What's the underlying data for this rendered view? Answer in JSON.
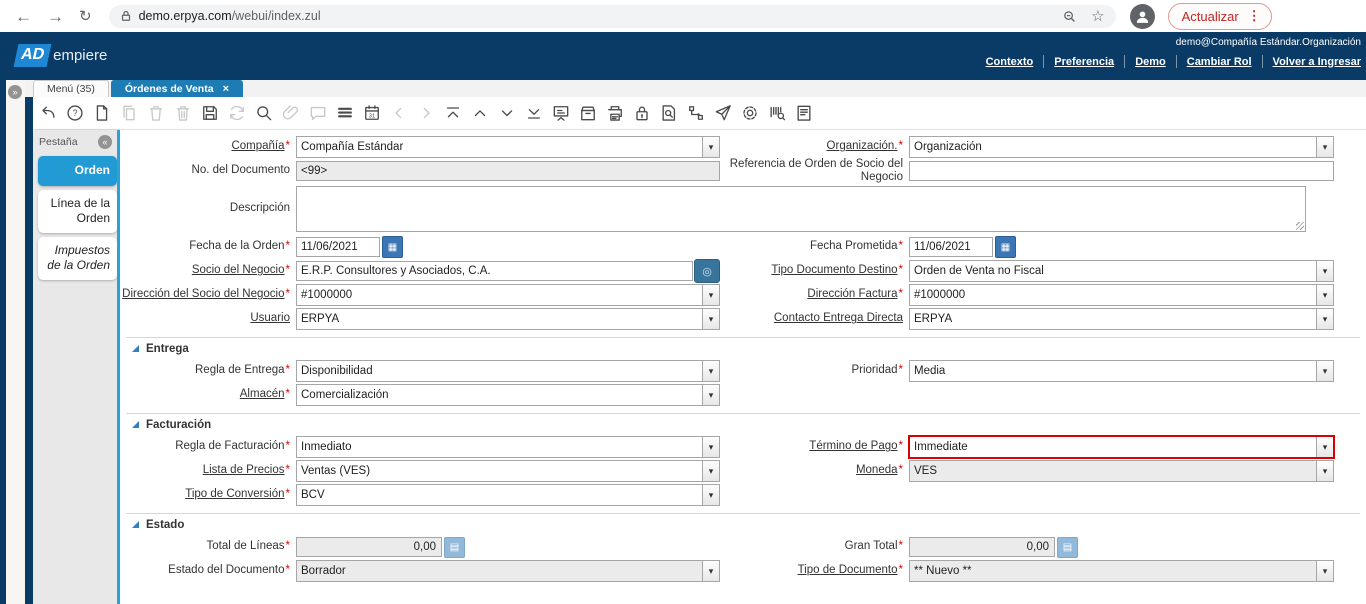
{
  "browser": {
    "url": {
      "domain": "demo.erpya.com",
      "path": "/webui/index.zul"
    },
    "refresh_button_label": "Actualizar"
  },
  "header": {
    "logo": {
      "ad": "AD",
      "rest": "empiere"
    },
    "session": "demo@Compañía Estándar.Organización",
    "links": [
      "Contexto",
      "Preferencia",
      "Demo",
      "Cambiar Rol",
      "Volver a Ingresar"
    ]
  },
  "tabbar": {
    "expand_button": "»",
    "tabs": [
      {
        "label": "Menú (35)",
        "active": false,
        "closable": false
      },
      {
        "label": "Órdenes de Venta",
        "active": true,
        "closable": true
      }
    ]
  },
  "toolbar": {
    "icons": [
      {
        "name": "undo",
        "enabled": true
      },
      {
        "name": "help",
        "enabled": true
      },
      {
        "name": "new-record",
        "enabled": true
      },
      {
        "name": "copy-record",
        "enabled": false
      },
      {
        "name": "delete-record",
        "enabled": false
      },
      {
        "name": "delete-selection",
        "enabled": false
      },
      {
        "name": "save",
        "enabled": true
      },
      {
        "name": "refresh",
        "enabled": false
      },
      {
        "name": "find",
        "enabled": true
      },
      {
        "name": "attachment",
        "enabled": false
      },
      {
        "name": "chat",
        "enabled": false
      },
      {
        "name": "grid-toggle",
        "enabled": true
      },
      {
        "name": "calendar",
        "enabled": true
      },
      {
        "name": "nav-left",
        "enabled": false
      },
      {
        "name": "nav-right",
        "enabled": false
      },
      {
        "name": "first-record",
        "enabled": true
      },
      {
        "name": "previous-record",
        "enabled": true
      },
      {
        "name": "next-record",
        "enabled": true
      },
      {
        "name": "last-record",
        "enabled": true
      },
      {
        "name": "report",
        "enabled": true
      },
      {
        "name": "archive",
        "enabled": true
      },
      {
        "name": "print",
        "enabled": true
      },
      {
        "name": "lock-private",
        "enabled": true
      },
      {
        "name": "record-info",
        "enabled": true
      },
      {
        "name": "workflow",
        "enabled": true
      },
      {
        "name": "request",
        "enabled": true
      },
      {
        "name": "preferences",
        "enabled": true
      },
      {
        "name": "product-info",
        "enabled": true
      },
      {
        "name": "report-view",
        "enabled": true
      }
    ]
  },
  "sidebar": {
    "title": "Pestaña",
    "collapse_button": "«",
    "tabs": [
      {
        "label": "Orden",
        "active": true,
        "italic": false
      },
      {
        "label": "Línea de la Orden",
        "active": false,
        "italic": false
      },
      {
        "label": "Impuestos de la Orden",
        "active": false,
        "italic": true
      }
    ]
  },
  "form": {
    "required_marker": "*",
    "sections": [
      {
        "title": "",
        "rows": [
          {
            "left": {
              "id": "compania",
              "label": "Compañía",
              "required": true,
              "underlined": true,
              "type": "combo",
              "value": "Compañía Estándar"
            },
            "right": {
              "id": "organizacion",
              "label": "Organización.",
              "required": true,
              "underlined": true,
              "type": "combo",
              "value": "Organización"
            }
          },
          {
            "left": {
              "id": "no-documento",
              "label": "No. del Documento",
              "required": false,
              "underlined": false,
              "type": "text-readonly",
              "value": "<99>"
            },
            "right": {
              "id": "referencia-orden-socio",
              "label": "Referencia de Orden de Socio del Negocio",
              "required": false,
              "underlined": false,
              "type": "text",
              "value": ""
            }
          },
          {
            "full": {
              "id": "descripcion",
              "label": "Descripción",
              "required": false,
              "underlined": false,
              "type": "textarea",
              "value": ""
            }
          },
          {
            "left": {
              "id": "fecha-orden",
              "label": "Fecha de la Orden",
              "required": true,
              "underlined": false,
              "type": "date",
              "value": "11/06/2021"
            },
            "right": {
              "id": "fecha-prometida",
              "label": "Fecha Prometida",
              "required": true,
              "underlined": false,
              "type": "date",
              "value": "11/06/2021"
            }
          },
          {
            "left": {
              "id": "socio-negocio",
              "label": "Socio del Negocio",
              "required": true,
              "underlined": true,
              "type": "lookup",
              "value": "E.R.P. Consultores y Asociados, C.A."
            },
            "right": {
              "id": "tipo-documento-destino",
              "label": "Tipo Documento Destino",
              "required": true,
              "underlined": true,
              "type": "combo",
              "value": "Orden de Venta no Fiscal"
            }
          },
          {
            "left": {
              "id": "direccion-socio",
              "label": "Dirección del Socio del Negocio",
              "required": true,
              "underlined": true,
              "type": "combo",
              "value": "#1000000"
            },
            "right": {
              "id": "direccion-factura",
              "label": "Dirección Factura",
              "required": true,
              "underlined": true,
              "type": "combo",
              "value": "#1000000"
            }
          },
          {
            "left": {
              "id": "usuario",
              "label": "Usuario",
              "required": false,
              "underlined": true,
              "type": "combo",
              "value": "ERPYA"
            },
            "right": {
              "id": "contacto-entrega-directa",
              "label": "Contacto Entrega Directa",
              "required": false,
              "underlined": true,
              "type": "combo",
              "value": "ERPYA"
            }
          }
        ]
      },
      {
        "title": "Entrega",
        "rows": [
          {
            "left": {
              "id": "regla-entrega",
              "label": "Regla de Entrega",
              "required": true,
              "underlined": false,
              "type": "combo",
              "value": "Disponibilidad"
            },
            "right": {
              "id": "prioridad",
              "label": "Prioridad",
              "required": true,
              "underlined": false,
              "type": "combo",
              "value": "Media"
            }
          },
          {
            "left": {
              "id": "almacen",
              "label": "Almacén",
              "required": true,
              "underlined": true,
              "type": "combo",
              "value": "Comercialización"
            }
          }
        ]
      },
      {
        "title": "Facturación",
        "rows": [
          {
            "left": {
              "id": "regla-facturacion",
              "label": "Regla de Facturación",
              "required": true,
              "underlined": false,
              "type": "combo",
              "value": "Inmediato"
            },
            "right": {
              "id": "termino-pago",
              "label": "Término de Pago",
              "required": true,
              "underlined": true,
              "type": "combo",
              "value": "Immediate",
              "highlight": true
            }
          },
          {
            "left": {
              "id": "lista-precios",
              "label": "Lista de Precios",
              "required": true,
              "underlined": true,
              "type": "combo",
              "value": "Ventas (VES)"
            },
            "right": {
              "id": "moneda",
              "label": "Moneda",
              "required": true,
              "underlined": true,
              "type": "combo-readonly",
              "value": "VES"
            }
          },
          {
            "left": {
              "id": "tipo-conversion",
              "label": "Tipo de Conversión",
              "required": true,
              "underlined": true,
              "type": "combo",
              "value": "BCV"
            }
          }
        ]
      },
      {
        "title": "Estado",
        "rows": [
          {
            "left": {
              "id": "total-lineas",
              "label": "Total de Líneas",
              "required": true,
              "underlined": false,
              "type": "amount",
              "value": "0,00"
            },
            "right": {
              "id": "gran-total",
              "label": "Gran Total",
              "required": true,
              "underlined": false,
              "type": "amount",
              "value": "0,00"
            }
          },
          {
            "left": {
              "id": "estado-documento",
              "label": "Estado del Documento",
              "required": true,
              "underlined": false,
              "type": "combo-readonly",
              "value": "Borrador"
            },
            "right": {
              "id": "tipo-documento",
              "label": "Tipo de Documento",
              "required": true,
              "underlined": true,
              "type": "combo-readonly",
              "value": "** Nuevo **"
            }
          }
        ]
      }
    ]
  },
  "colors": {
    "header_navy": "#0a3a66",
    "logo_blue": "#1e88d4",
    "window_tab_blue": "#1d7cb4",
    "sidebar_tab_blue": "#229ad3",
    "accent_line_blue": "#29a2da",
    "section_triangle_blue": "#2f7fc1",
    "date_button_blue": "#3c76b5",
    "lookup_button_blue": "#38759d",
    "calculator_button_blue": "#92b9da",
    "highlight_red": "#d80000",
    "required_red": "#e00000",
    "actualizar_red": "#c5221f"
  }
}
